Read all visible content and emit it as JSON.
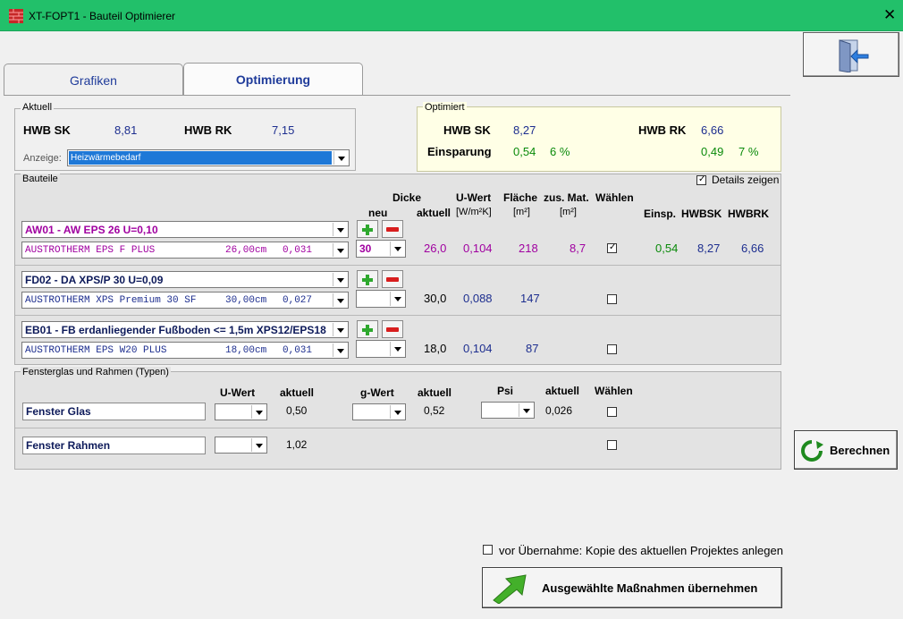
{
  "window": {
    "title": "XT-FOPT1 - Bauteil Optimierer",
    "close": "✕"
  },
  "tabs": [
    {
      "label": "Grafiken"
    },
    {
      "label": "Optimierung"
    }
  ],
  "aktuell": {
    "legend": "Aktuell",
    "hwb_sk_label": "HWB SK",
    "hwb_sk_value": "8,81",
    "hwb_rk_label": "HWB RK",
    "hwb_rk_value": "7,15",
    "anzeige_label": "Anzeige:",
    "anzeige_value": "Heizwärmebedarf"
  },
  "optimiert": {
    "legend": "Optimiert",
    "hwb_sk_label": "HWB SK",
    "hwb_sk_value": "8,27",
    "hwb_rk_label": "HWB RK",
    "hwb_rk_value": "6,66",
    "einsparung_label": "Einsparung",
    "einsparung_sk": "0,54",
    "einsparung_sk_pct": "6 %",
    "einsparung_rk": "0,49",
    "einsparung_rk_pct": "7 %"
  },
  "bauteile": {
    "legend": "Bauteile",
    "details_label": "Details zeigen",
    "details_checked": true,
    "headers": {
      "dicke": "Dicke",
      "neu": "neu",
      "aktuell": "aktuell",
      "uwert": "U-Wert",
      "uwert_unit": "[W/m²K]",
      "flaeche": "Fläche",
      "flaeche_unit": "[m²]",
      "zusmat": "zus. Mat.",
      "zusmat_unit": "[m²]",
      "waehlen": "Wählen",
      "einsp": "Einsp.",
      "hwbsk": "HWBSK",
      "hwbrk": "HWBRK"
    },
    "rows": [
      {
        "name": "AW01 - AW EPS 26 U=0,10",
        "material": "AUSTROTHERM EPS F PLUS",
        "mat_dicke": "26,00cm",
        "mat_lambda": "0,031",
        "neu": "30",
        "aktuell": "26,0",
        "uwert": "0,104",
        "flaeche": "218",
        "zusmat": "8,7",
        "checked": true,
        "einsp": "0,54",
        "hwbsk": "8,27",
        "hwbrk": "6,66"
      },
      {
        "name": "FD02 - DA XPS/P 30 U=0,09",
        "material": "AUSTROTHERM XPS Premium 30 SF",
        "mat_dicke": "30,00cm",
        "mat_lambda": "0,027",
        "neu": "",
        "aktuell": "30,0",
        "uwert": "0,088",
        "flaeche": "147",
        "zusmat": "",
        "checked": false,
        "einsp": "",
        "hwbsk": "",
        "hwbrk": ""
      },
      {
        "name": "EB01 - FB  erdanliegender Fußboden <= 1,5m XPS12/EPS18",
        "material": "AUSTROTHERM EPS W20 PLUS",
        "mat_dicke": "18,00cm",
        "mat_lambda": "0,031",
        "neu": "",
        "aktuell": "18,0",
        "uwert": "0,104",
        "flaeche": "87",
        "zusmat": "",
        "checked": false,
        "einsp": "",
        "hwbsk": "",
        "hwbrk": ""
      }
    ]
  },
  "fenster": {
    "legend": "Fensterglas und Rahmen  (Typen)",
    "headers": {
      "uwert": "U-Wert",
      "aktuell": "aktuell",
      "gwert": "g-Wert",
      "aktuell2": "aktuell",
      "psi": "Psi",
      "aktuell3": "aktuell",
      "waehlen": "Wählen"
    },
    "glas": {
      "label": "Fenster Glas",
      "u_aktuell": "0,50",
      "g_aktuell": "0,52",
      "psi_aktuell": "0,026"
    },
    "rahmen": {
      "label": "Fenster Rahmen",
      "u_aktuell": "1,02"
    }
  },
  "berechnen_label": "Berechnen",
  "kopie_label": "vor Übernahme: Kopie des aktuellen Projektes anlegen",
  "uebernehmen_label": "Ausgewählte Maßnahmen übernehmen"
}
